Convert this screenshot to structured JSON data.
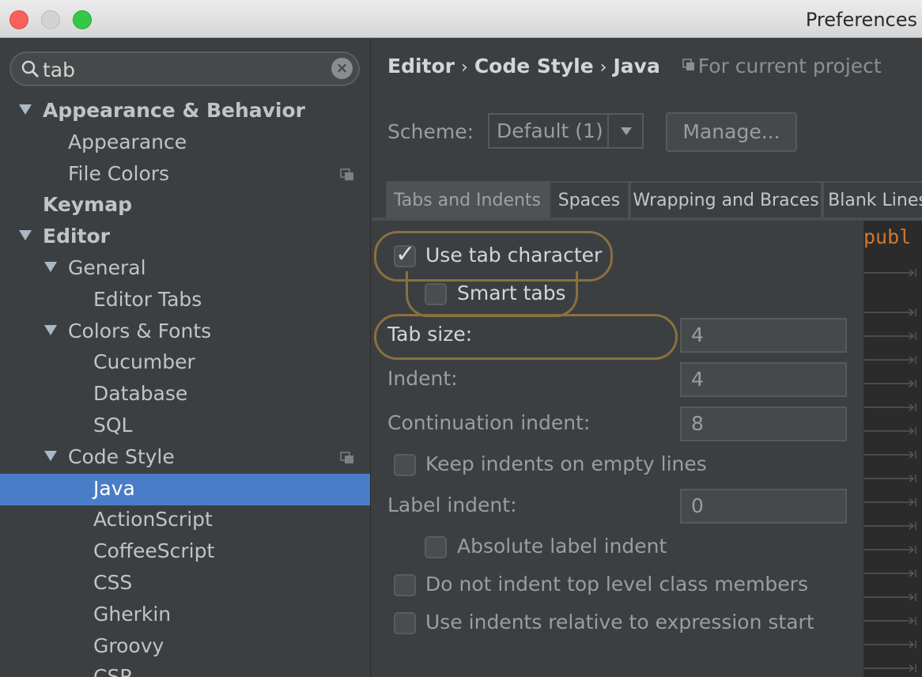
{
  "window": {
    "title": "Preferences"
  },
  "search": {
    "value": "tab"
  },
  "tree": [
    {
      "label": "Appearance & Behavior",
      "bold": true,
      "expanded": true
    },
    {
      "label": "Appearance"
    },
    {
      "label": "File Colors",
      "project_icon": true
    },
    {
      "label": "Keymap",
      "bold": true
    },
    {
      "label": "Editor",
      "bold": true,
      "expanded": true
    },
    {
      "label": "General",
      "expanded": true
    },
    {
      "label": "Editor Tabs"
    },
    {
      "label": "Colors & Fonts",
      "expanded": true
    },
    {
      "label": "Cucumber"
    },
    {
      "label": "Database"
    },
    {
      "label": "SQL"
    },
    {
      "label": "Code Style",
      "expanded": true,
      "project_icon": true
    },
    {
      "label": "Java",
      "selected": true
    },
    {
      "label": "ActionScript"
    },
    {
      "label": "CoffeeScript"
    },
    {
      "label": "CSS"
    },
    {
      "label": "Gherkin"
    },
    {
      "label": "Groovy"
    },
    {
      "label": "CSP"
    }
  ],
  "breadcrumb": {
    "parts": [
      "Editor",
      "Code Style",
      "Java"
    ],
    "separator": "›",
    "project_note": "For current project"
  },
  "scheme": {
    "label": "Scheme:",
    "value": "Default (1)",
    "manage_label": "Manage..."
  },
  "tabs": [
    {
      "label": "Tabs and Indents",
      "active": true
    },
    {
      "label": "Spaces"
    },
    {
      "label": "Wrapping and Braces"
    },
    {
      "label": "Blank Lines"
    }
  ],
  "options": {
    "use_tab_character": {
      "label": "Use tab character",
      "checked": true
    },
    "smart_tabs": {
      "label": "Smart tabs",
      "checked": false
    },
    "tab_size": {
      "label": "Tab size:",
      "value": "4"
    },
    "indent": {
      "label": "Indent:",
      "value": "4"
    },
    "continuation_indent": {
      "label": "Continuation indent:",
      "value": "8"
    },
    "keep_indents_empty": {
      "label": "Keep indents on empty lines",
      "checked": false
    },
    "label_indent": {
      "label": "Label indent:",
      "value": "0"
    },
    "absolute_label_indent": {
      "label": "Absolute label indent",
      "checked": false
    },
    "no_indent_top_level": {
      "label": "Do not indent top level class members",
      "checked": false
    },
    "relative_indents": {
      "label": "Use indents relative to expression start",
      "checked": false
    }
  },
  "preview": {
    "code_fragment": "publ"
  },
  "colors": {
    "selection": "#4a7dc7",
    "highlight": "#8a7040",
    "keyword": "#cc7832"
  }
}
